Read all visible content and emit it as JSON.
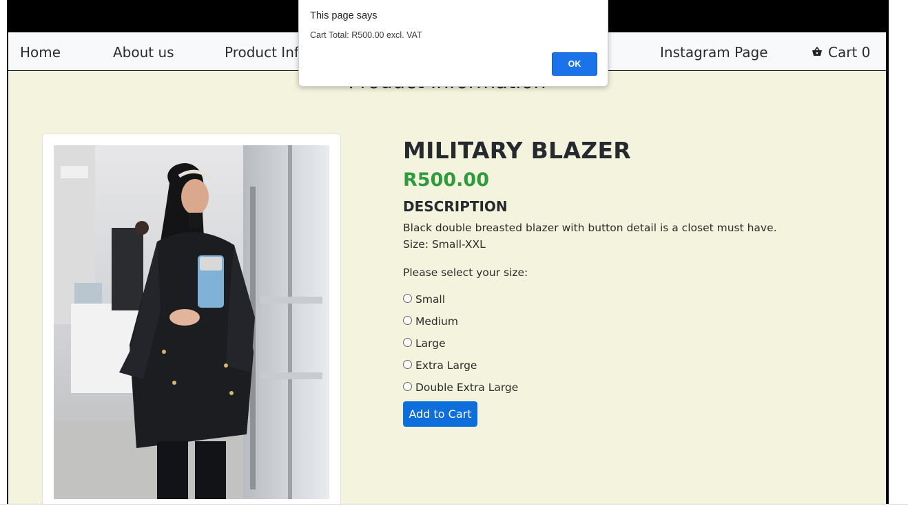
{
  "nav": {
    "home": "Home",
    "about": "About us",
    "product_info": "Product Info",
    "instagram": "Instagram Page",
    "cart_label": "Cart 0",
    "cart_icon": "basket-icon"
  },
  "page": {
    "heading": "Product Information"
  },
  "product": {
    "name": "MILITARY BLAZER",
    "price": "R500.00",
    "description_heading": "DESCRIPTION",
    "description": "Black double breasted blazer with button detail is a closet must have.",
    "size_range": "Size: Small-XXL",
    "size_prompt": "Please select your size:",
    "sizes": [
      "Small",
      "Medium",
      "Large",
      "Extra Large",
      "Double Extra Large"
    ],
    "add_to_cart": "Add to Cart"
  },
  "dialog": {
    "title": "This page says",
    "message": "Cart Total: R500.00 excl. VAT",
    "ok": "OK"
  },
  "colors": {
    "content_bg": "#f4f4de",
    "price": "#2e9b3e",
    "primary_button": "#0d6edc",
    "dialog_button": "#1a73e8"
  }
}
